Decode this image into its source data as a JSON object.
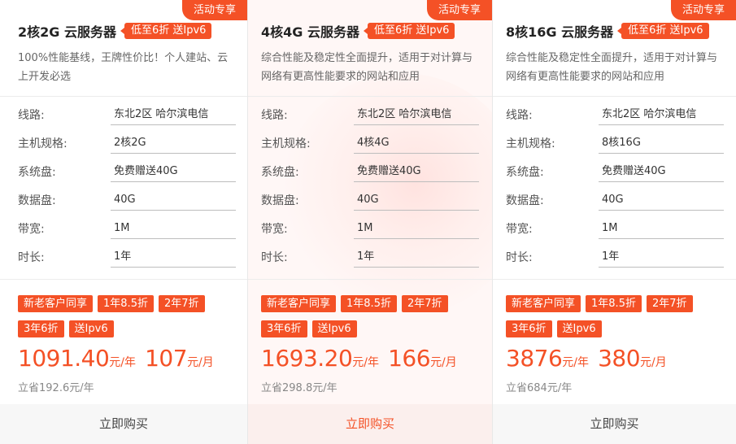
{
  "cards": [
    {
      "ribbon": "活动专享",
      "title": "2核2G 云服务器",
      "promo": "低至6折 送Ipv6",
      "desc": "100%性能基线，王牌性价比！个人建站、云上开发必选",
      "specs": [
        {
          "label": "线路:",
          "value": "东北2区 哈尔滨电信"
        },
        {
          "label": "主机规格:",
          "value": "2核2G"
        },
        {
          "label": "系统盘:",
          "value": "免费赠送40G"
        },
        {
          "label": "数据盘:",
          "value": "40G"
        },
        {
          "label": "带宽:",
          "value": "1M"
        },
        {
          "label": "时长:",
          "value": "1年"
        }
      ],
      "tags": [
        "新老客户同享",
        "1年8.5折",
        "2年7折",
        "3年6折",
        "送Ipv6"
      ],
      "price_year": "1091.40",
      "unit_year": "元/年",
      "price_month": "107",
      "unit_month": "元/月",
      "save": "立省192.6元/年",
      "buy": "立即购买"
    },
    {
      "ribbon": "活动专享",
      "title": "4核4G 云服务器",
      "promo": "低至6折 送Ipv6",
      "desc": "综合性能及稳定性全面提升，适用于对计算与网络有更高性能要求的网站和应用",
      "specs": [
        {
          "label": "线路:",
          "value": "东北2区 哈尔滨电信"
        },
        {
          "label": "主机规格:",
          "value": "4核4G"
        },
        {
          "label": "系统盘:",
          "value": "免费赠送40G"
        },
        {
          "label": "数据盘:",
          "value": "40G"
        },
        {
          "label": "带宽:",
          "value": "1M"
        },
        {
          "label": "时长:",
          "value": "1年"
        }
      ],
      "tags": [
        "新老客户同享",
        "1年8.5折",
        "2年7折",
        "3年6折",
        "送Ipv6"
      ],
      "price_year": "1693.20",
      "unit_year": "元/年",
      "price_month": "166",
      "unit_month": "元/月",
      "save": "立省298.8元/年",
      "buy": "立即购买"
    },
    {
      "ribbon": "活动专享",
      "title": "8核16G 云服务器",
      "promo": "低至6折 送Ipv6",
      "desc": "综合性能及稳定性全面提升，适用于对计算与网络有更高性能要求的网站和应用",
      "specs": [
        {
          "label": "线路:",
          "value": "东北2区 哈尔滨电信"
        },
        {
          "label": "主机规格:",
          "value": "8核16G"
        },
        {
          "label": "系统盘:",
          "value": "免费赠送40G"
        },
        {
          "label": "数据盘:",
          "value": "40G"
        },
        {
          "label": "带宽:",
          "value": "1M"
        },
        {
          "label": "时长:",
          "value": "1年"
        }
      ],
      "tags": [
        "新老客户同享",
        "1年8.5折",
        "2年7折",
        "3年6折",
        "送Ipv6"
      ],
      "price_year": "3876",
      "unit_year": "元/年",
      "price_month": "380",
      "unit_month": "元/月",
      "save": "立省684元/年",
      "buy": "立即购买"
    }
  ],
  "colors": {
    "accent": "#f45126",
    "featured_bg": "#fff7f6"
  }
}
